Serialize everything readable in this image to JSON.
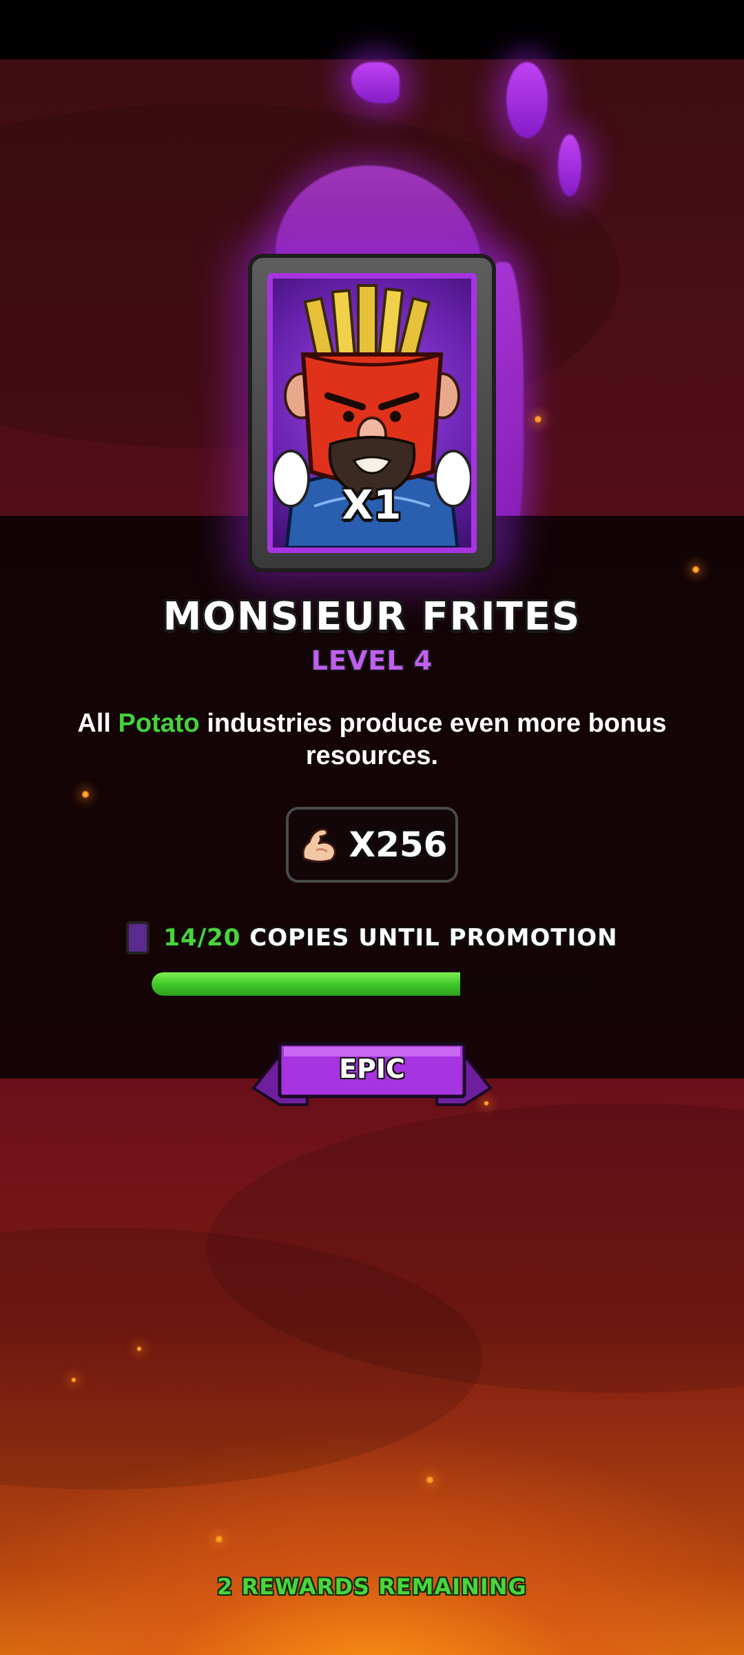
{
  "reward": {
    "quantity": "X1",
    "hero_name": "MONSIEUR FRITES",
    "level": "LEVEL 4",
    "description": {
      "prefix": "All ",
      "highlight": "Potato",
      "suffix": " industries produce even more bonus resources."
    },
    "power": {
      "icon": "flexed-bicep-icon",
      "value": "X256"
    },
    "copies": {
      "icon": "card-icon",
      "count": "14/20",
      "label": "COPIES UNTIL PROMOTION",
      "progress_fraction": 0.7
    },
    "rarity": "EPIC"
  },
  "footer": {
    "rewards_remaining": "2 REWARDS REMAINING"
  },
  "colors": {
    "rarity_purple": "#a634e0",
    "highlight_green": "#44d23c",
    "level_purple": "#c05ff0",
    "progress_green": "#3dc428"
  }
}
